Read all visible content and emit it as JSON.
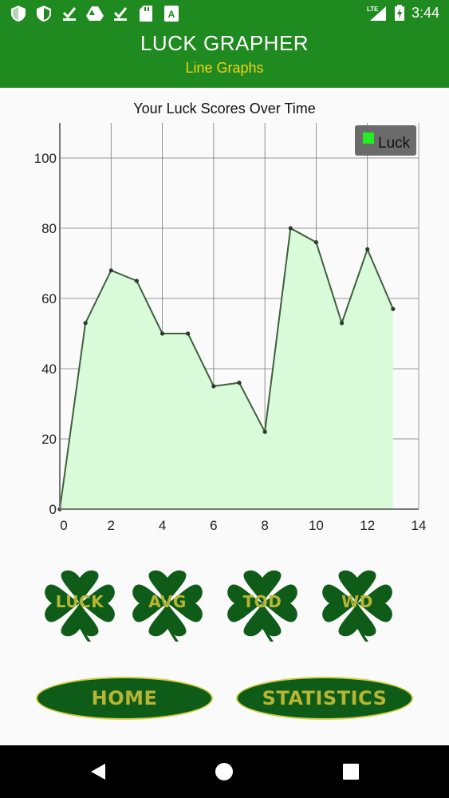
{
  "status_bar": {
    "icons_left": [
      "shield-icon",
      "shield-icon",
      "download-done-icon",
      "drive-icon",
      "download-done-icon",
      "sd-card-icon",
      "app-store-icon"
    ],
    "network": "LTE",
    "time": "3:44"
  },
  "header": {
    "title": "LUCK GRAPHER",
    "subtitle": "Line Graphs"
  },
  "chart_data": {
    "type": "area",
    "title": "Your Luck Scores Over Time",
    "xlabel": "",
    "ylabel": "",
    "x": [
      0,
      1,
      2,
      3,
      4,
      5,
      6,
      7,
      8,
      9,
      10,
      11,
      12,
      13
    ],
    "series": [
      {
        "name": "Luck",
        "values": [
          0,
          53,
          68,
          65,
          50,
          50,
          35,
          36,
          22,
          80,
          76,
          53,
          74,
          57
        ]
      }
    ],
    "xlim": [
      0,
      14
    ],
    "ylim": [
      0,
      110
    ],
    "x_ticks": [
      "0",
      "2",
      "4",
      "6",
      "8",
      "10",
      "12",
      "14"
    ],
    "y_ticks": [
      "0",
      "20",
      "40",
      "60",
      "80",
      "100"
    ],
    "grid": true,
    "legend": "top-right",
    "colors": {
      "line": "#3f5f3f",
      "fill": "#d9fbd9",
      "legend_swatch": "#22ee22",
      "legend_bg": "#6b6b6b"
    }
  },
  "clover_buttons": [
    {
      "label": "LUCK"
    },
    {
      "label": "AVG"
    },
    {
      "label": "TOD"
    },
    {
      "label": "WD"
    }
  ],
  "buttons": {
    "home": "HOME",
    "statistics": "STATISTICS"
  },
  "nav": [
    "back-icon",
    "home-icon",
    "recents-icon"
  ],
  "colors": {
    "primary": "#1f8a1f",
    "accent_text": "#f2d11b",
    "clover": "#0f5c19",
    "button_text": "#b7b533"
  }
}
